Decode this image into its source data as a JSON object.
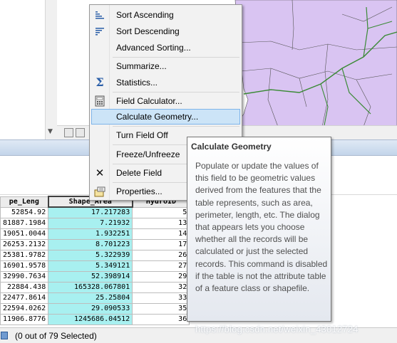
{
  "context_menu": {
    "items": [
      {
        "label": "Sort Ascending",
        "icon": "sort-ascending-icon"
      },
      {
        "label": "Sort Descending",
        "icon": "sort-descending-icon"
      },
      {
        "label": "Advanced Sorting...",
        "icon": ""
      },
      {
        "label": "Summarize...",
        "icon": ""
      },
      {
        "label": "Statistics...",
        "icon": "sigma-icon"
      },
      {
        "label": "Field Calculator...",
        "icon": "calculator-icon"
      },
      {
        "label": "Calculate Geometry...",
        "icon": "",
        "highlighted": true
      },
      {
        "label": "Turn Field Off",
        "icon": ""
      },
      {
        "label": "Freeze/Unfreeze",
        "icon": ""
      },
      {
        "label": "Delete Field",
        "icon": "delete-x-icon"
      },
      {
        "label": "Properties...",
        "icon": "properties-icon"
      }
    ]
  },
  "tooltip": {
    "title": "Calculate Geometry",
    "body": "Populate or update the values of this field to be geometric values derived from the features that the table represents, such as area, perimeter, length, etc. The dialog that appears lets you choose whether all the records will be calculated or just the selected records. This command is disabled if the table is not the attribute table of a feature class or shapefile."
  },
  "table": {
    "columns": [
      "pe_Leng",
      "Shape_Area",
      "HydroID"
    ],
    "rows": [
      [
        "52854.92",
        "17.217283",
        "5"
      ],
      [
        "81887.1984",
        "7.21932",
        "13"
      ],
      [
        "19051.0044",
        "1.932251",
        "14"
      ],
      [
        "26253.2132",
        "8.701223",
        "17"
      ],
      [
        "25381.9782",
        "5.322939",
        "26"
      ],
      [
        "16901.9578",
        "5.349121",
        "27"
      ],
      [
        "32990.7634",
        "52.398914",
        "29"
      ],
      [
        "22884.438",
        "165328.067801",
        "32"
      ],
      [
        "22477.8614",
        "25.25804",
        "33"
      ],
      [
        "22594.0262",
        "29.090533",
        "35"
      ],
      [
        "11906.8776",
        "1245686.04512",
        "36"
      ]
    ]
  },
  "status": {
    "selection": "(0 out of 79 Selected)"
  },
  "watermark": "https://blog.csdn.net/weixin_43012724",
  "colors": {
    "map_fill": "#d9c4f2",
    "river": "#3a8a35",
    "highlight_cell": "#a8f0f0",
    "menu_hover": "#cce4f7"
  }
}
